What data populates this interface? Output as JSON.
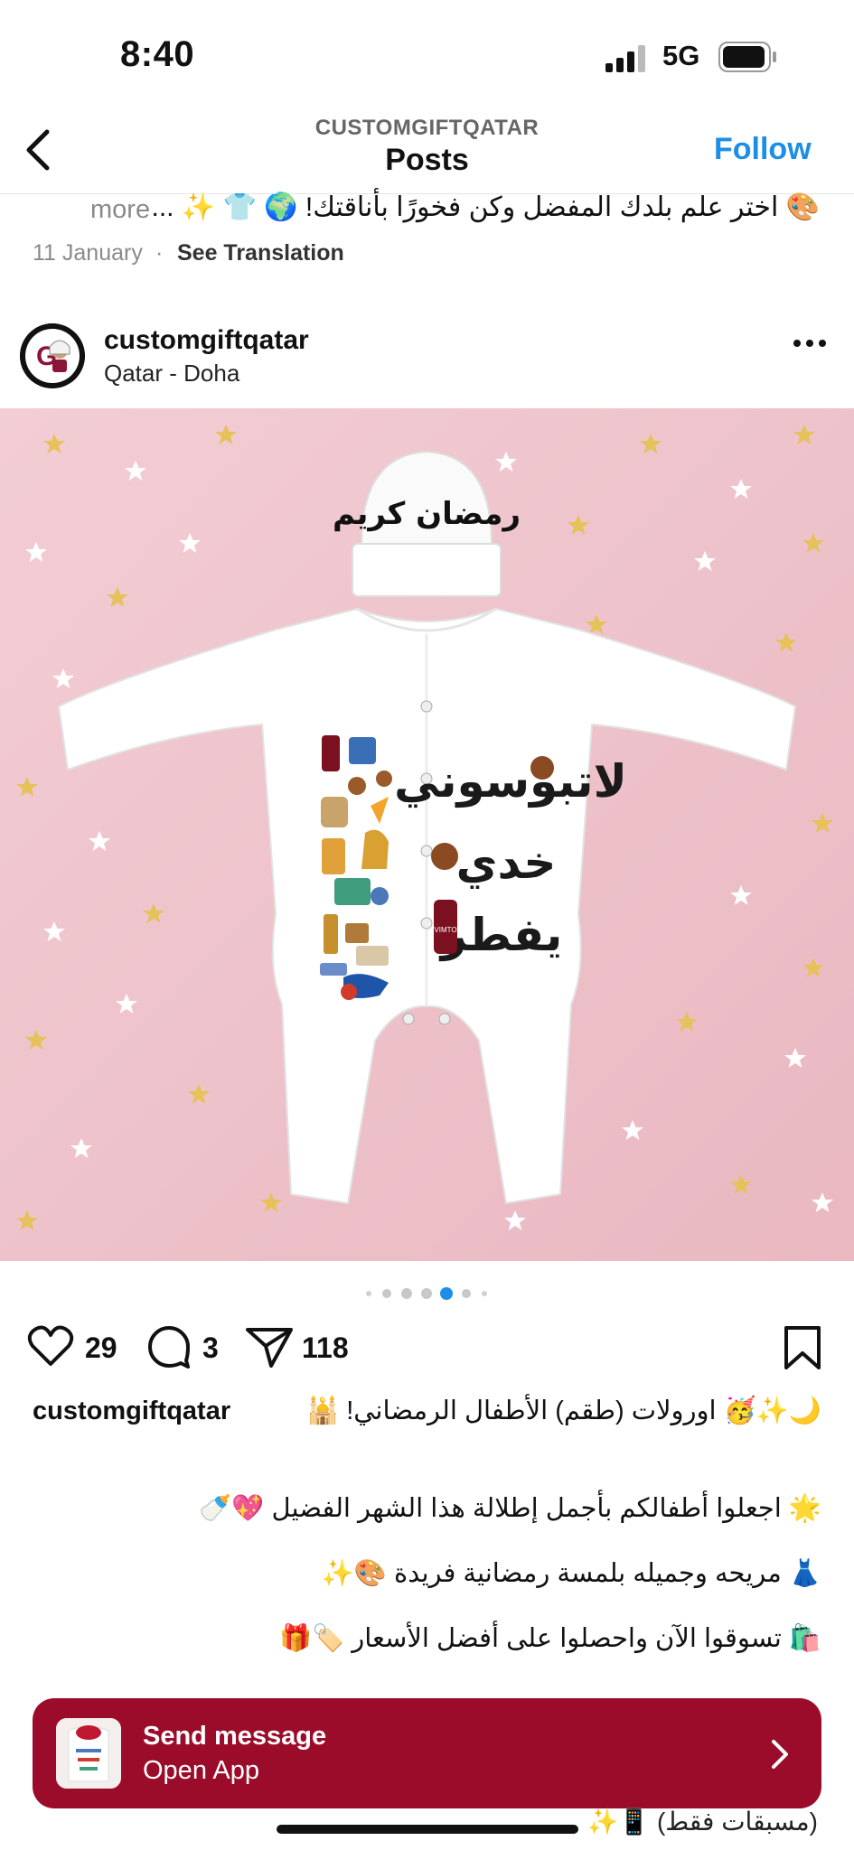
{
  "status_bar": {
    "time": "8:40",
    "network": "5G"
  },
  "header": {
    "subtitle": "CUSTOMGIFTQATAR",
    "title": "Posts",
    "follow_label": "Follow"
  },
  "previous_post": {
    "caption": "🎨 اختر علم بلدك المفضل وكن فخورًا بأناقتك! 🌍 👕 ✨ ...",
    "more_label": "more",
    "date": "11 January",
    "translation_label": "See Translation"
  },
  "post": {
    "username": "customgiftqatar",
    "location": "Qatar - Doha",
    "image": {
      "hat_text": "رمضان كريم",
      "body_text_1": "لاتبوسوني",
      "body_text_2": "خدي",
      "body_text_3": "يفطر",
      "bottle_label": "VIMTO",
      "background": "#f0c7cf"
    },
    "carousel": {
      "count": 7,
      "active_index": 4
    },
    "likes": "29",
    "comments": "3",
    "shares": "118",
    "caption_username": "customgiftqatar",
    "caption_lines": [
      "🌙✨🥳 اورولات (طقم) الأطفال الرمضاني! 🕌",
      "🌟 اجعلوا أطفالكم بأجمل إطلالة هذا الشهر الفضيل 💖🍼",
      "👗 مريحه وجميله بلمسة رمضانية فريدة 🎨✨",
      "🛍️ تسوقوا الآن واحصلوا على أفضل الأسعار 🏷️🎁"
    ]
  },
  "send_message": {
    "title": "Send message",
    "subtitle": "Open App",
    "bar_color": "#9b0c2a"
  },
  "cut_off_text": "(مسبقات فقط) 📱✨",
  "colors": {
    "accent": "#1d8ee6",
    "text": "#111111",
    "muted": "#8a8a8a"
  },
  "icons": [
    "back-chevron-icon",
    "heart-icon",
    "comment-icon",
    "share-icon",
    "bookmark-icon",
    "more-icon",
    "chevron-right-icon"
  ]
}
